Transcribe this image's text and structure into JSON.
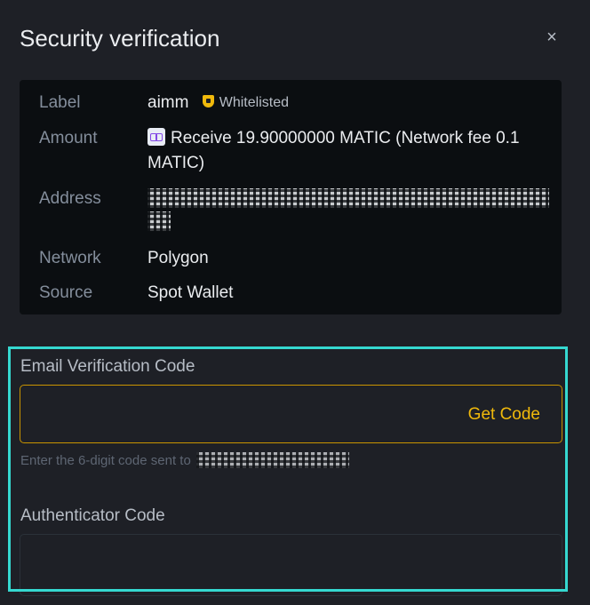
{
  "modal": {
    "title": "Security verification",
    "close_glyph": "×"
  },
  "details": {
    "label": {
      "key": "Label",
      "value": "aimm",
      "badge": "Whitelisted",
      "badge_icon": "shield-icon"
    },
    "amount": {
      "key": "Amount",
      "value": "Receive 19.90000000 MATIC (Network fee 0.1 MATIC)",
      "coin_icon": "matic-coin-icon"
    },
    "address": {
      "key": "Address"
    },
    "network": {
      "key": "Network",
      "value": "Polygon"
    },
    "source": {
      "key": "Source",
      "value": "Spot Wallet"
    }
  },
  "email_verification": {
    "label": "Email Verification Code",
    "value": "",
    "get_code_label": "Get Code",
    "helper_text": "Enter the 6-digit code sent to"
  },
  "authenticator": {
    "label": "Authenticator Code",
    "value": ""
  },
  "colors": {
    "accent": "#f0b90b",
    "highlight": "#35d8d0",
    "background": "#1e2026",
    "panel": "#0b0e11"
  }
}
